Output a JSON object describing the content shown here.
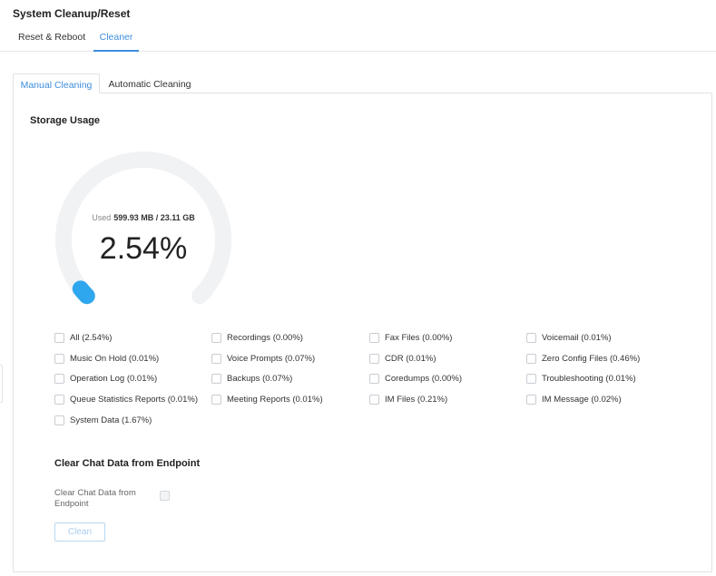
{
  "page": {
    "title": "System Cleanup/Reset"
  },
  "top_tabs": [
    {
      "label": "Reset & Reboot",
      "active": false
    },
    {
      "label": "Cleaner",
      "active": true
    }
  ],
  "inner_tabs": [
    {
      "label": "Manual Cleaning",
      "active": true
    },
    {
      "label": "Automatic Cleaning",
      "active": false
    }
  ],
  "storage": {
    "title": "Storage Usage",
    "used_label": "Used",
    "used_value": "599.93 MB / 23.11 GB",
    "percent_text": "2.54%",
    "percent": 2.54,
    "track_color": "#f1f2f4",
    "fill_color": "#2ea7ee"
  },
  "checkboxes": [
    {
      "label": "All (2.54%)",
      "checked": false
    },
    {
      "label": "Recordings (0.00%)",
      "checked": false
    },
    {
      "label": "Fax Files (0.00%)",
      "checked": false
    },
    {
      "label": "Voicemail (0.01%)",
      "checked": false
    },
    {
      "label": "Music On Hold (0.01%)",
      "checked": false
    },
    {
      "label": "Voice Prompts (0.07%)",
      "checked": false
    },
    {
      "label": "CDR (0.01%)",
      "checked": false
    },
    {
      "label": "Zero Config Files (0.46%)",
      "checked": false
    },
    {
      "label": "Operation Log (0.01%)",
      "checked": false
    },
    {
      "label": "Backups (0.07%)",
      "checked": false
    },
    {
      "label": "Coredumps (0.00%)",
      "checked": false
    },
    {
      "label": "Troubleshooting (0.01%)",
      "checked": false
    },
    {
      "label": "Queue Statistics Reports (0.01%)",
      "checked": false
    },
    {
      "label": "Meeting Reports (0.01%)",
      "checked": false
    },
    {
      "label": "IM Files (0.21%)",
      "checked": false
    },
    {
      "label": "IM Message (0.02%)",
      "checked": false
    },
    {
      "label": "System Data (1.67%)",
      "checked": false
    }
  ],
  "chat": {
    "title": "Clear Chat Data from Endpoint",
    "field_label": "Clear Chat Data from Endpoint",
    "checked": false,
    "disabled": true
  },
  "clean_button": {
    "label": "Clean",
    "disabled": true
  },
  "colors": {
    "accent": "#3d8ede",
    "border": "#dfe2e6"
  }
}
